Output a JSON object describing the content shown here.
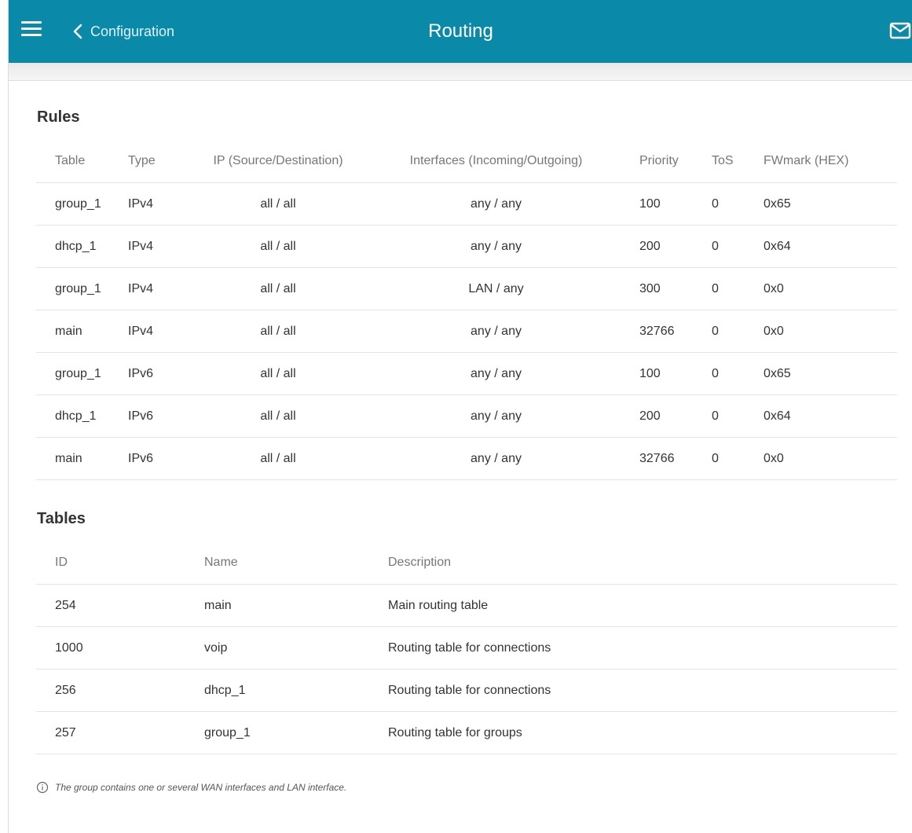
{
  "header": {
    "back_label": "Configuration",
    "title": "Routing",
    "menu_icon": "hamburger-menu-icon",
    "back_icon": "chevron-left-icon",
    "mail_icon": "envelope-icon",
    "bar_color": "#0a89a8"
  },
  "rules": {
    "title": "Rules",
    "columns": [
      "Table",
      "Type",
      "IP (Source/Destination)",
      "Interfaces (Incoming/Outgoing)",
      "Priority",
      "ToS",
      "FWmark (HEX)"
    ],
    "rows": [
      [
        "group_1",
        "IPv4",
        "all / all",
        "any / any",
        "100",
        "0",
        "0x65"
      ],
      [
        "dhcp_1",
        "IPv4",
        "all / all",
        "any / any",
        "200",
        "0",
        "0x64"
      ],
      [
        "group_1",
        "IPv4",
        "all / all",
        "LAN / any",
        "300",
        "0",
        "0x0"
      ],
      [
        "main",
        "IPv4",
        "all / all",
        "any / any",
        "32766",
        "0",
        "0x0"
      ],
      [
        "group_1",
        "IPv6",
        "all / all",
        "any / any",
        "100",
        "0",
        "0x65"
      ],
      [
        "dhcp_1",
        "IPv6",
        "all / all",
        "any / any",
        "200",
        "0",
        "0x64"
      ],
      [
        "main",
        "IPv6",
        "all / all",
        "any / any",
        "32766",
        "0",
        "0x0"
      ]
    ]
  },
  "tables": {
    "title": "Tables",
    "columns": [
      "ID",
      "Name",
      "Description"
    ],
    "rows": [
      [
        "254",
        "main",
        "Main routing table"
      ],
      [
        "1000",
        "voip",
        "Routing table for connections"
      ],
      [
        "256",
        "dhcp_1",
        "Routing table for connections"
      ],
      [
        "257",
        "group_1",
        "Routing table for groups"
      ]
    ]
  },
  "note": {
    "icon": "info-circle-icon",
    "text": "The group contains one or several WAN interfaces and LAN interface."
  }
}
